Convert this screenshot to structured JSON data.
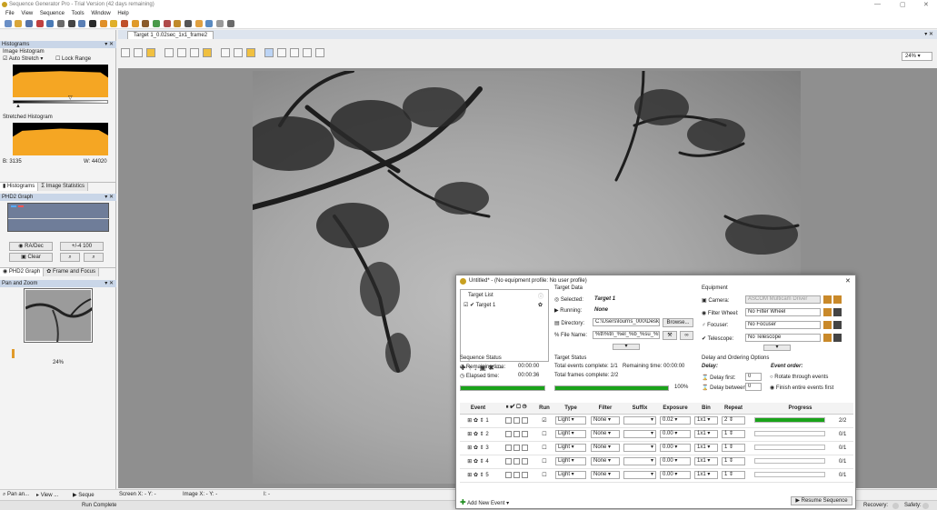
{
  "window": {
    "title": "Sequence Generator Pro - Trial Version (42 days remaining)"
  },
  "menu": [
    "File",
    "View",
    "Sequence",
    "Tools",
    "Window",
    "Help"
  ],
  "left": {
    "histograms_title": "Histograms",
    "image_histogram": "Image Histogram",
    "auto_stretch": "Auto Stretch",
    "lock_range": "Lock Range",
    "stretched_histogram": "Stretched Histogram",
    "b_value": "B: 3135",
    "w_value": "W: 44020",
    "tab_histograms": "Histograms",
    "tab_image_statistics": "Image Statistics",
    "phd2_title": "PHD2 Graph",
    "ra_dec": "RA/Dec",
    "scale": "+/-4 100",
    "clear": "Clear",
    "tab_phd2": "PHD2 Graph",
    "tab_frame_focus": "Frame and Focus",
    "pan_zoom_title": "Pan and Zoom",
    "pan_zoom_value": "24%"
  },
  "document": {
    "tab_label": "Target 1_0.02sec_1x1_frame2",
    "zoom": "24%"
  },
  "status": {
    "tab_pan": "Pan an...",
    "tab_view": "View ...",
    "tab_seq": "Seque",
    "screen_xy": "Screen X: - Y: -",
    "image_xy": "Image X: - Y: -",
    "intensity": "I: -",
    "run_complete": "Run Complete",
    "recovery": "Recovery:",
    "safety": "Safety:"
  },
  "dialog": {
    "title": "Untitled* - (No equipment profile: No user profile)",
    "target_list": "Target List",
    "target1": "Target 1",
    "target_data": "Target Data",
    "selected_label": "Selected:",
    "selected_value": "Target 1",
    "running_label": "Running:",
    "running_value": "None",
    "directory_label": "Directory:",
    "directory_value": "C:\\Users\\lourns_000\\Deskto",
    "browse": "Browse...",
    "filename_label": "File Name:",
    "filename_value": "%tl\\%tn_%el_%b_%su_%fn",
    "equipment": "Equipment",
    "camera_label": "Camera:",
    "camera_value": "ASCOM Multicam Driver",
    "filter_label": "Filter Wheel:",
    "filter_value": "No Filter Wheel",
    "focuser_label": "Focuser:",
    "focuser_value": "No Focuser",
    "telescope_label": "Telescope:",
    "telescope_value": "No Telescope",
    "sequence_status": "Sequence Status",
    "remaining_label": "Remaining time:",
    "remaining_value": "00:00:00",
    "elapsed_label": "Elapsed time:",
    "elapsed_value": "00:00:36",
    "target_status": "Target Status",
    "total_events": "Total events complete: 1/1",
    "remaining_time_t": "Remaining time: 00:00:00",
    "total_frames": "Total frames complete: 2/2",
    "target_pct": "100%",
    "seq_progress": 1.0,
    "target_progress": 1.0,
    "delay_title": "Delay and Ordering Options",
    "delay": "Delay:",
    "event_order": "Event order:",
    "delay_first": "Delay first:",
    "delay_first_val": "0",
    "delay_between": "Delay between:",
    "delay_between_val": "0",
    "rotate": "Rotate through events",
    "finish": "Finish entire events first",
    "columns": [
      "Event",
      "",
      "Run",
      "Type",
      "Filter",
      "Suffix",
      "Exposure",
      "Bin",
      "Repeat",
      "Progress"
    ],
    "rows": [
      {
        "num": "1",
        "run": true,
        "type": "Light",
        "filter": "None",
        "suffix": "",
        "exposure": "0.02",
        "bin": "1x1",
        "repeat": "2",
        "progress_text": "2/2",
        "fill": 1.0
      },
      {
        "num": "2",
        "run": false,
        "type": "Light",
        "filter": "None",
        "suffix": "",
        "exposure": "0.00",
        "bin": "1x1",
        "repeat": "1",
        "progress_text": "0/1",
        "fill": 0.0
      },
      {
        "num": "3",
        "run": false,
        "type": "Light",
        "filter": "None",
        "suffix": "",
        "exposure": "0.00",
        "bin": "1x1",
        "repeat": "1",
        "progress_text": "0/1",
        "fill": 0.0
      },
      {
        "num": "4",
        "run": false,
        "type": "Light",
        "filter": "None",
        "suffix": "",
        "exposure": "0.00",
        "bin": "1x1",
        "repeat": "1",
        "progress_text": "0/1",
        "fill": 0.0
      },
      {
        "num": "5",
        "run": false,
        "type": "Light",
        "filter": "None",
        "suffix": "",
        "exposure": "0.00",
        "bin": "1x1",
        "repeat": "1",
        "progress_text": "0/1",
        "fill": 0.0
      }
    ],
    "add_new_event": "Add New Event",
    "resume_sequence": "Resume Sequence",
    "accent_green": "#1aa31a"
  }
}
